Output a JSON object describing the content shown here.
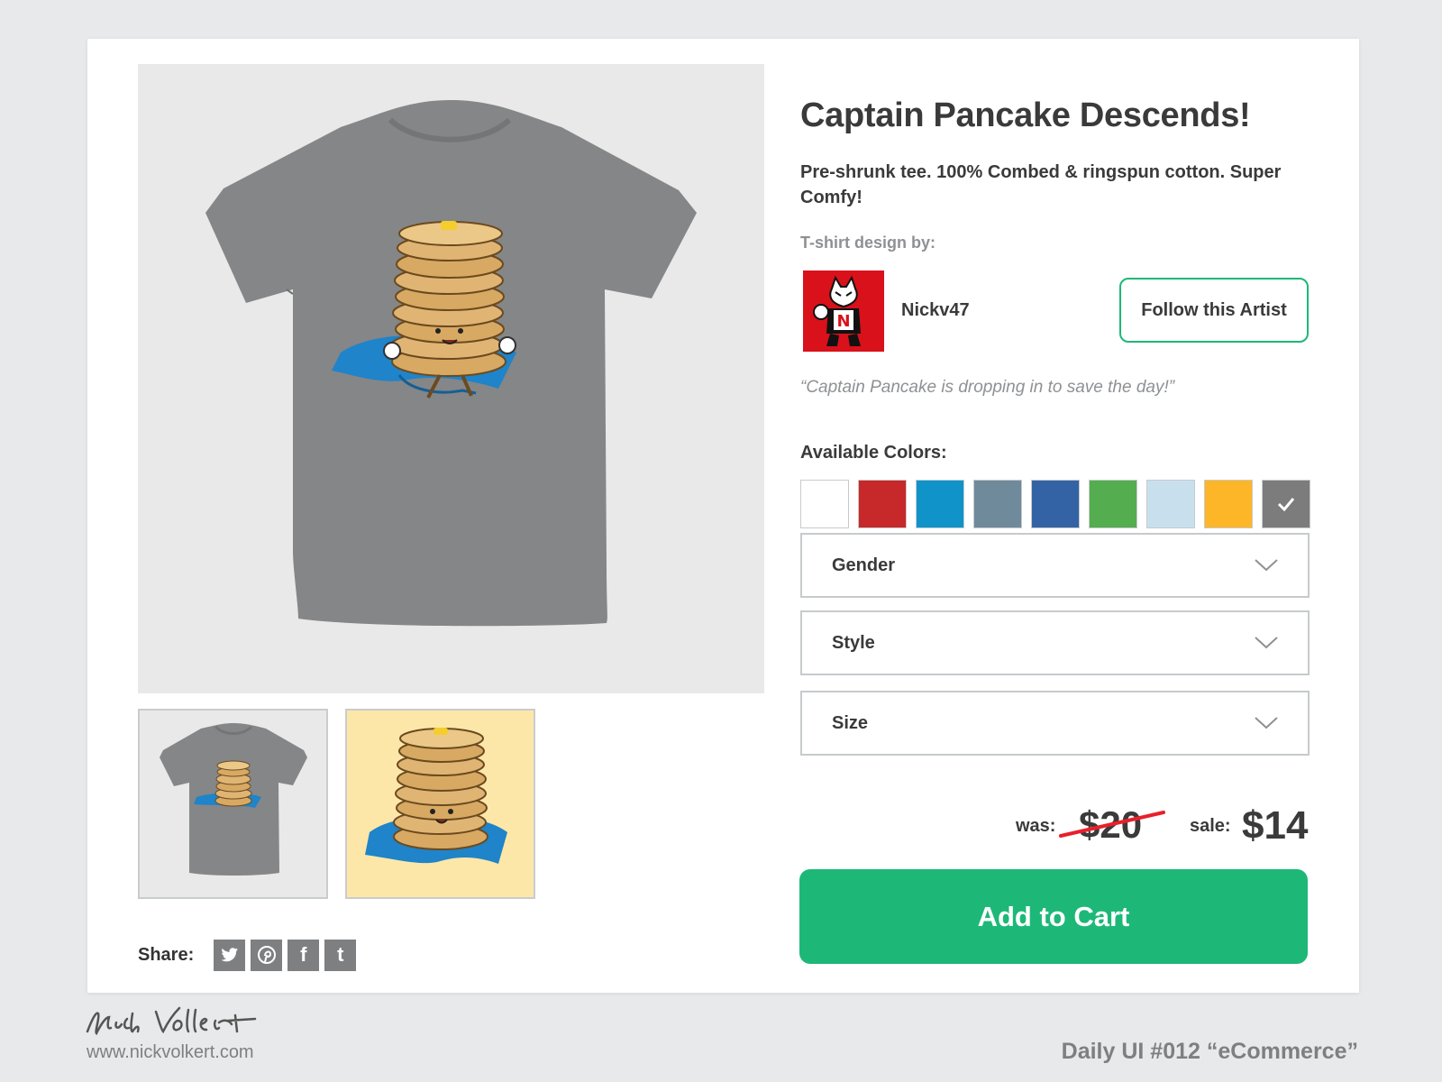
{
  "product": {
    "title": "Captain Pancake Descends!",
    "description": "Pre-shrunk tee. 100% Combed & ringspun cotton. Super Comfy!",
    "design_by_label": "T-shirt design by:",
    "quote": "“Captain Pancake is dropping in to save the day!”",
    "main_image_icon": "tshirt-pancake-illustration",
    "thumbnails": [
      {
        "icon": "tshirt-thumbnail",
        "background": "#e9e9ea"
      },
      {
        "icon": "pancake-art-thumbnail",
        "background": "#fde7a8"
      }
    ]
  },
  "artist": {
    "name": "Nickv47",
    "avatar_icon": "husky-mascot-avatar",
    "follow_label": "Follow this Artist"
  },
  "colors": {
    "label": "Available Colors:",
    "swatches": [
      {
        "hex": "#ffffff",
        "selected": false
      },
      {
        "hex": "#c7282a",
        "selected": false
      },
      {
        "hex": "#0f93c9",
        "selected": false
      },
      {
        "hex": "#6f8b9b",
        "selected": false
      },
      {
        "hex": "#3363a4",
        "selected": false
      },
      {
        "hex": "#54ad4f",
        "selected": false
      },
      {
        "hex": "#c8e0ee",
        "selected": false
      },
      {
        "hex": "#fcb627",
        "selected": false
      },
      {
        "hex": "#7c7c7c",
        "selected": true
      }
    ]
  },
  "selects": {
    "gender": "Gender",
    "style": "Style",
    "size": "Size"
  },
  "price": {
    "was_label": "was:",
    "was": "$20",
    "sale_label": "sale:",
    "sale": "$14"
  },
  "cart": {
    "label": "Add to Cart"
  },
  "share": {
    "label": "Share:",
    "icons": [
      "twitter-icon",
      "pinterest-icon",
      "facebook-icon",
      "tumblr-icon"
    ],
    "facebook_glyph": "f",
    "tumblr_glyph": "t"
  },
  "footer": {
    "site": "www.nickvolkert.com",
    "label": "Daily UI #012 “eCommerce”"
  },
  "theme": {
    "accent": "#1db877",
    "text": "#3a3a3a",
    "muted": "#8e9194",
    "border": "#c7cacc"
  }
}
